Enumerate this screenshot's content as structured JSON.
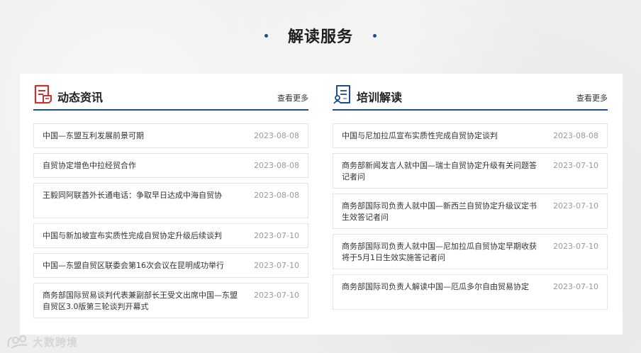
{
  "page_title": "解读服务",
  "colors": {
    "accent": "#1c4e8a",
    "icon_red": "#c8332e",
    "icon_blue": "#1c4e8a"
  },
  "news": {
    "title": "动态资讯",
    "icon": "news-document-icon",
    "more_label": "查看更多",
    "items": [
      {
        "title": "中国—东盟互利发展前景可期",
        "date": "2023-08-08"
      },
      {
        "title": "自贸协定增色中拉经贸合作",
        "date": "2023-08-08"
      },
      {
        "title": "王毅同阿联酋外长通电话：争取早日达成中海自贸协",
        "date": "2023-08-08"
      },
      {
        "title": "中国与新加坡宣布实质性完成自贸协定升级后续谈判",
        "date": "2023-07-10"
      },
      {
        "title": "中国—东盟自贸区联委会第16次会议在昆明成功举行",
        "date": "2023-07-10"
      },
      {
        "title": "商务部国际贸易谈判代表兼副部长王受文出席中国—东盟自贸区3.0版第三轮谈判开幕式",
        "date": "2023-07-10"
      }
    ]
  },
  "training": {
    "title": "培训解读",
    "icon": "training-document-icon",
    "more_label": "查看更多",
    "items": [
      {
        "title": "中国与尼加拉瓜宣布实质性完成自贸协定谈判",
        "date": "2023-08-08"
      },
      {
        "title": "商务部新闻发言人就中国—瑞士自贸协定升级有关问题答记者问",
        "date": "2023-07-10"
      },
      {
        "title": "商务部国际司负责人就中国—新西兰自贸协定升级议定书生效答记者问",
        "date": "2023-07-10"
      },
      {
        "title": "商务部国际司负责人就中国—尼加拉瓜自贸协定早期收获将于5月1日生效实施答记者问",
        "date": "2023-07-10"
      },
      {
        "title": "商务部国际司负责人解读中国—厄瓜多尔自由贸易协定",
        "date": "2023-07-10"
      }
    ]
  },
  "watermark": {
    "text": "大数跨境"
  }
}
